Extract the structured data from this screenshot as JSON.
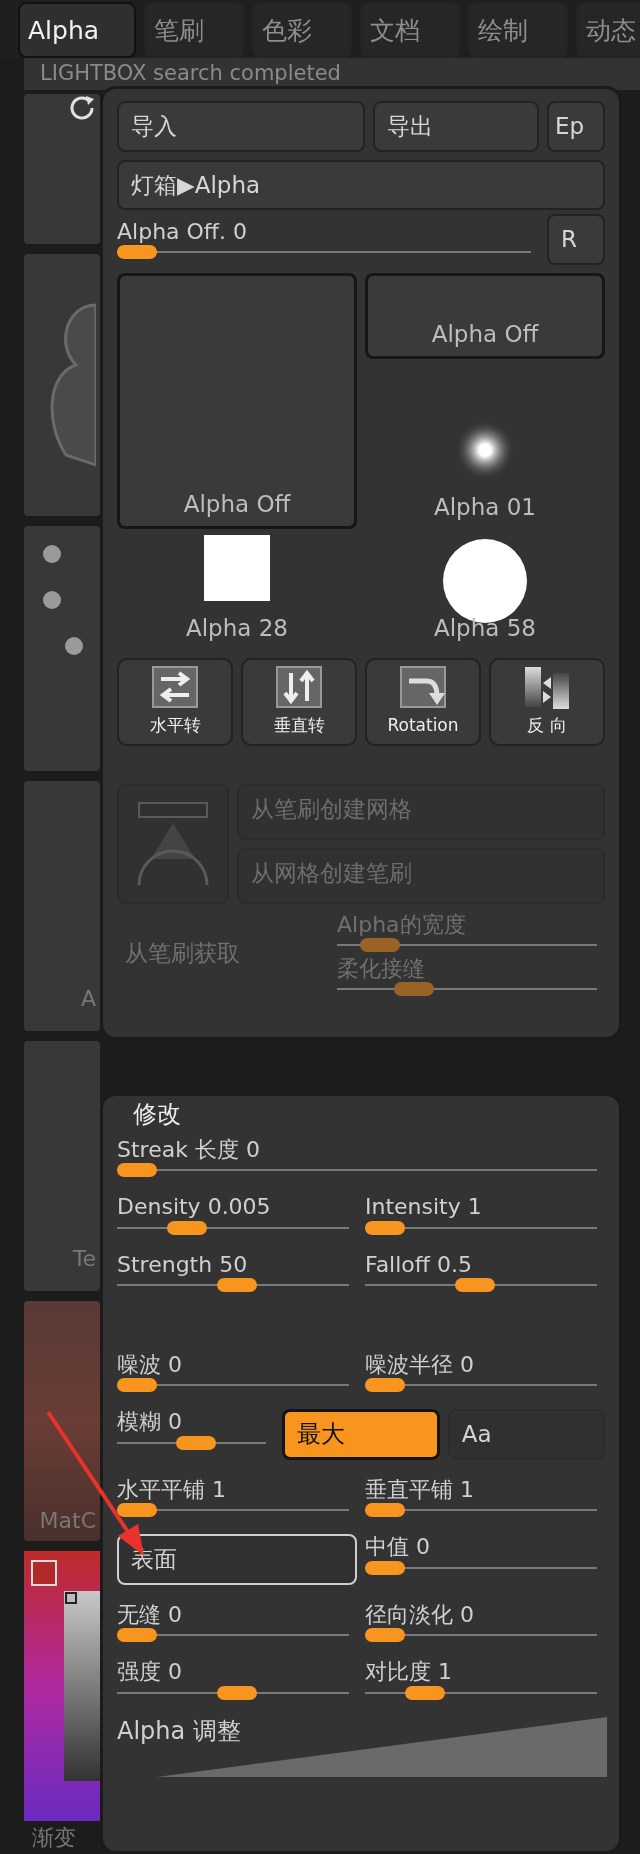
{
  "tabs": [
    {
      "label": "Alpha",
      "selected": true
    },
    {
      "label": "笔刷",
      "selected": false
    },
    {
      "label": "色彩",
      "selected": false
    },
    {
      "label": "文档",
      "selected": false
    },
    {
      "label": "绘制",
      "selected": false
    },
    {
      "label": "动态",
      "selected": false
    }
  ],
  "background": {
    "status": "LIGHTBOX search completed",
    "side_labels": [
      "A",
      "Te",
      "MatC",
      "渐变"
    ]
  },
  "alpha_panel": {
    "top_buttons": [
      {
        "label": "导入"
      },
      {
        "label": "导出"
      },
      {
        "label": "Ep"
      }
    ],
    "lightbox_button": "灯箱▶Alpha",
    "alpha_slider": {
      "label": "Alpha Off. 0",
      "level": 0
    },
    "reset_button": "R",
    "preview": {
      "label": "Alpha Off"
    },
    "thumbnails": [
      {
        "label": "Alpha Off",
        "selected": true,
        "kind": "empty"
      },
      {
        "label": "Alpha 01",
        "selected": false,
        "kind": "soft"
      },
      {
        "label": "Alpha 28",
        "selected": false,
        "kind": "square"
      },
      {
        "label": "Alpha 58",
        "selected": false,
        "kind": "circle"
      }
    ],
    "tools": [
      {
        "label": "水平转",
        "kind": "flip-h"
      },
      {
        "label": "垂直转",
        "kind": "flip-v"
      },
      {
        "label": "Rotation",
        "kind": "rotate"
      },
      {
        "label": "反 向",
        "kind": "invert"
      }
    ],
    "mesh_buttons": [
      {
        "label": "从笔刷创建网格",
        "disabled": true
      },
      {
        "label": "从网格创建笔刷",
        "disabled": true
      }
    ],
    "grab_button": {
      "label": "从笔刷获取",
      "disabled": true
    },
    "disabled_sliders": [
      {
        "label": "Alpha的宽度",
        "level": 0.1,
        "disabled": true
      },
      {
        "label": "柔化接缝",
        "level": 0.25,
        "disabled": true
      }
    ]
  },
  "modify_panel": {
    "title": "修改",
    "rows": [
      {
        "cells": [
          {
            "kind": "slider",
            "label": "Streak 长度 0",
            "level": 0
          }
        ]
      },
      {
        "cells": [
          {
            "kind": "slider",
            "label": "Density 0.005",
            "level": 0.25
          },
          {
            "kind": "slider",
            "label": "Intensity 1",
            "level": 0
          }
        ]
      },
      {
        "cells": [
          {
            "kind": "slider",
            "label": "Strength 50",
            "level": 0.5
          },
          {
            "kind": "slider",
            "label": "Falloff 0.5",
            "level": 0.45
          }
        ]
      },
      {
        "cells": [
          {
            "kind": "slider",
            "label": "噪波 0",
            "level": 0
          },
          {
            "kind": "slider",
            "label": "噪波半径 0",
            "level": 0
          }
        ]
      },
      {
        "cells": [
          {
            "kind": "slider",
            "label": "模糊 0",
            "level": 0.5
          },
          {
            "kind": "toggle",
            "label": "最大",
            "on": true
          },
          {
            "kind": "button",
            "label": "Aa",
            "selected": false
          }
        ]
      },
      {
        "cells": [
          {
            "kind": "slider",
            "label": "水平平铺 1",
            "level": 0
          },
          {
            "kind": "slider",
            "label": "垂直平铺 1",
            "level": 0
          }
        ]
      },
      {
        "cells": [
          {
            "kind": "button",
            "label": "表面",
            "selected": true
          },
          {
            "kind": "slider",
            "label": "中值 0",
            "level": 0
          }
        ]
      },
      {
        "cells": [
          {
            "kind": "slider",
            "label": "无缝 0",
            "level": 0
          },
          {
            "kind": "slider",
            "label": "径向淡化 0",
            "level": 0
          }
        ]
      },
      {
        "cells": [
          {
            "kind": "slider",
            "label": "强度 0",
            "level": 0.5
          },
          {
            "kind": "slider",
            "label": "对比度 1",
            "level": 0.2
          }
        ]
      }
    ],
    "curve_label": "Alpha 调整"
  }
}
